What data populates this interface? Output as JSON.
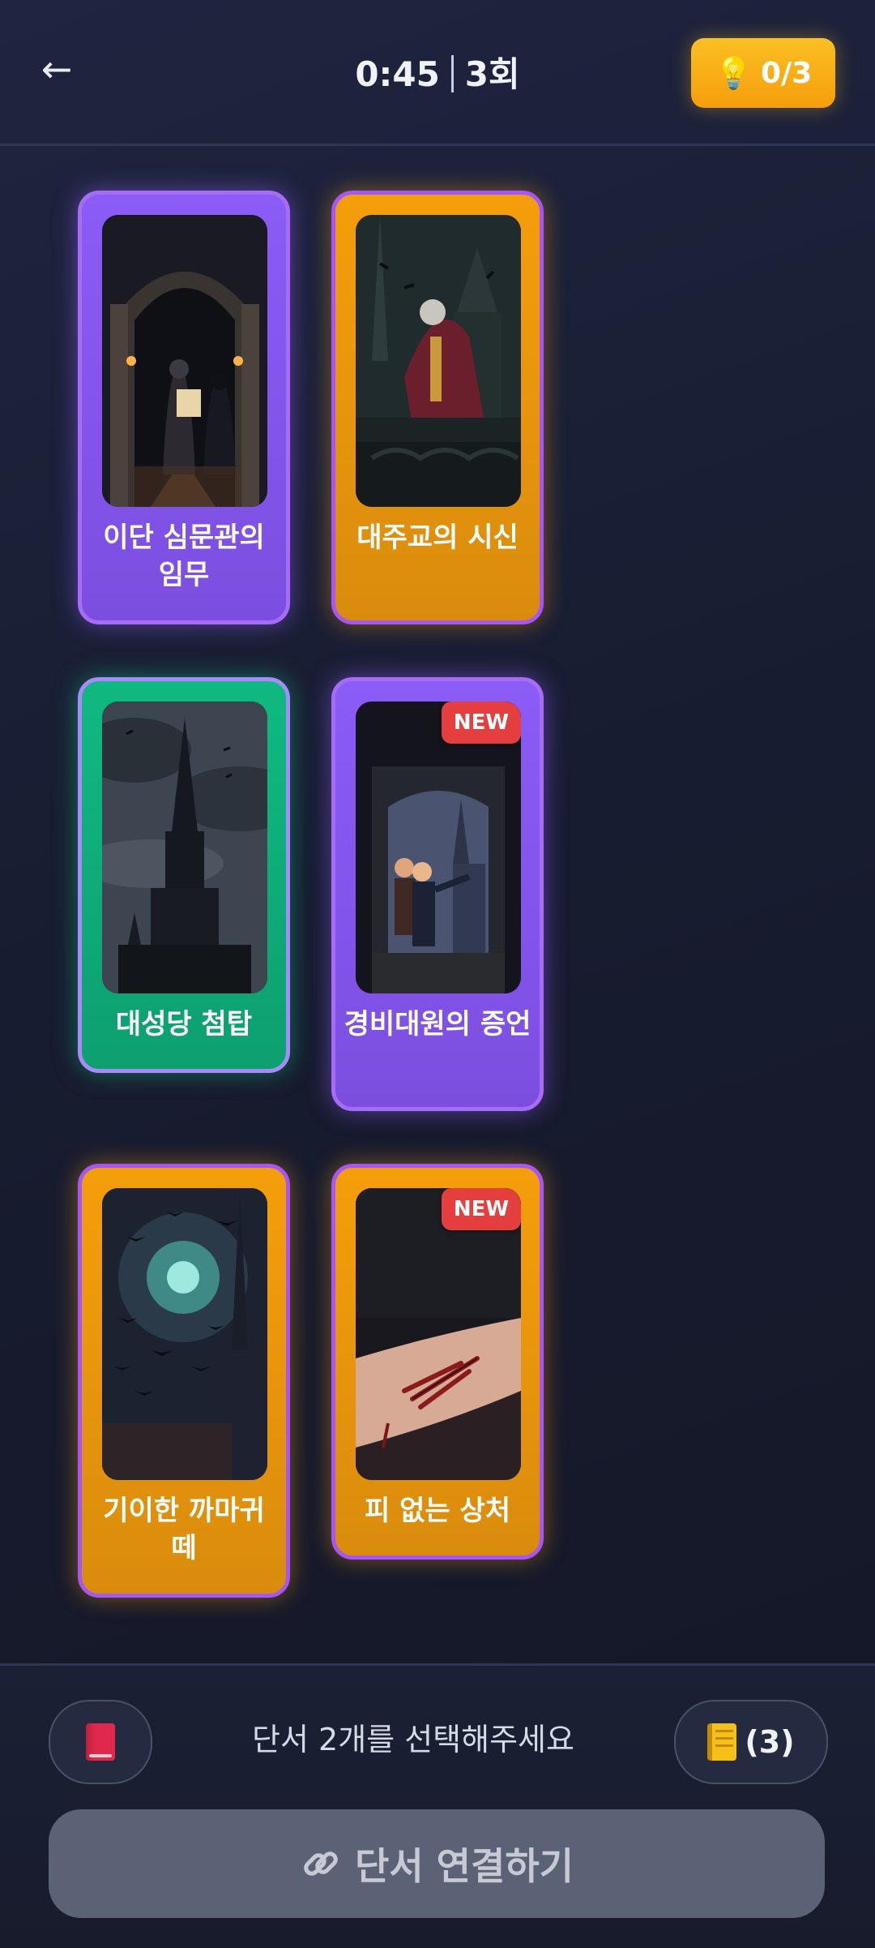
{
  "header": {
    "back_icon": "arrow-left-icon",
    "back_glyph": "←",
    "timer": "0:45",
    "attempts": "3회",
    "hint_icon": "lightbulb-icon",
    "hint_glyph": "💡",
    "hint_label": "0/3"
  },
  "cards": [
    {
      "title": "이단 심문관의 임무",
      "color": "#8b5cf6",
      "scene": "inquisitor-scroll",
      "is_new": false
    },
    {
      "title": "대주교의 시신",
      "color": "#f59e0b",
      "scene": "archbishop-body",
      "is_new": false
    },
    {
      "title": "대성당 첨탑",
      "color": "#10b981",
      "scene": "cathedral-spire",
      "is_new": false
    },
    {
      "title": "경비대원의 증언",
      "color": "#8b5cf6",
      "scene": "guards-pointing",
      "is_new": true
    },
    {
      "title": "기이한 까마귀 떼",
      "color": "#f59e0b",
      "scene": "crow-swarm",
      "is_new": false
    },
    {
      "title": "피 없는 상처",
      "color": "#f59e0b",
      "scene": "bloodless-wound",
      "is_new": true
    }
  ],
  "new_badge": "NEW",
  "bottom": {
    "book_icon": "red-book-icon",
    "instruction": "단서 2개를 선택해주세요",
    "notebook_icon": "notebook-icon",
    "notes_count": "(3)",
    "connect_icon": "link-icon",
    "connect_label": "단서 연결하기"
  }
}
